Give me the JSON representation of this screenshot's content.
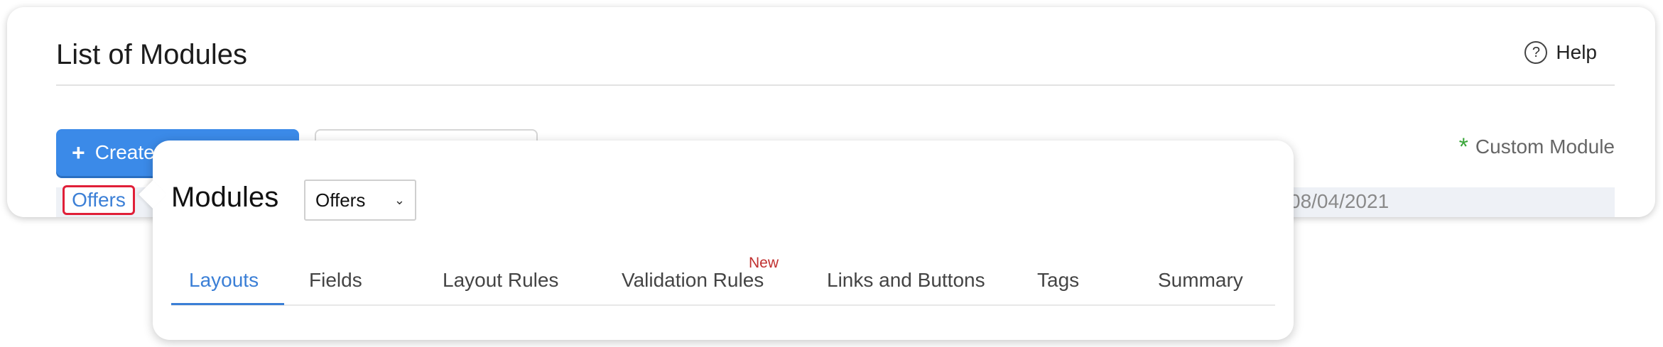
{
  "header": {
    "title": "List of Modules",
    "help_label": "Help",
    "help_icon": "?"
  },
  "toolbar": {
    "create_label": "Create",
    "create_icon": "+"
  },
  "legend": {
    "star": "*",
    "label": "Custom Module",
    "star_color": "#3aa63a"
  },
  "row": {
    "module_link": "Offers",
    "date": "08/04/2021"
  },
  "popover": {
    "title": "Modules",
    "selected_module": "Offers",
    "tabs": [
      {
        "label": "Layouts",
        "active": true
      },
      {
        "label": "Fields"
      },
      {
        "label": "Layout Rules"
      },
      {
        "label": "Validation Rules",
        "badge": "New"
      },
      {
        "label": "Links and Buttons"
      },
      {
        "label": "Tags"
      },
      {
        "label": "Summary"
      }
    ]
  },
  "colors": {
    "accent": "#3b7fd6",
    "primary_button": "#3b8ae8",
    "highlight_border": "#e01f38",
    "badge_new": "#c0302f"
  }
}
